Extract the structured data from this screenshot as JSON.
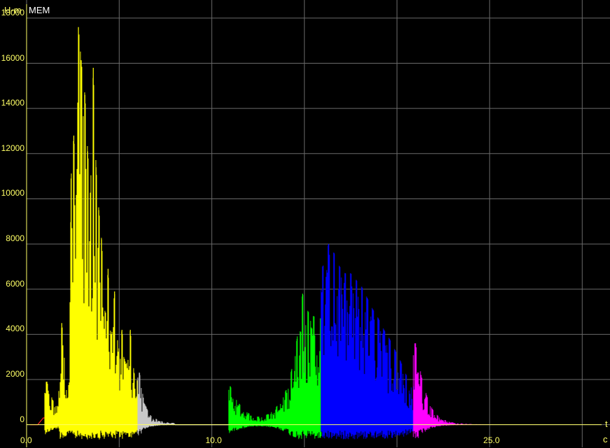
{
  "chart_data": {
    "type": "area",
    "ylabel": "Н·m",
    "title": "MEM",
    "xlabel": "t",
    "x_unit": "c",
    "xlim": [
      0,
      31.5
    ],
    "ylim": [
      -1000,
      18800
    ],
    "x_ticks": [
      0,
      5,
      10,
      15,
      20,
      25,
      30
    ],
    "x_tick_labels": [
      {
        "x": 0,
        "text": "0.0"
      },
      {
        "x": 10,
        "text": "10.0"
      },
      {
        "x": 25,
        "text": "25.0"
      }
    ],
    "y_ticks": [
      0,
      2000,
      4000,
      6000,
      8000,
      10000,
      12000,
      14000,
      16000,
      18000
    ],
    "y_tick_labels": [
      "0",
      "2000",
      "4000",
      "6000",
      "8000",
      "10000",
      "12000",
      "14000",
      "16000",
      "18000"
    ],
    "grid": true,
    "colors": {
      "background": "#000000",
      "grid": "#6a6a6a",
      "axis": "#ffff66",
      "text": "#ffff66",
      "title": "#ffffff"
    },
    "segments": [
      {
        "color": "#ff2020",
        "x_range": [
          0.2,
          1.0
        ],
        "points": [
          [
            0.2,
            0
          ],
          [
            0.6,
            0
          ],
          [
            0.9,
            300
          ],
          [
            1.0,
            300
          ]
        ]
      },
      {
        "color": "#ffff00",
        "x_range": [
          1.0,
          6.0
        ],
        "peaks": [
          [
            1.1,
            1900
          ],
          [
            1.4,
            1100
          ],
          [
            1.7,
            800
          ],
          [
            1.9,
            4500
          ],
          [
            2.3,
            1500
          ],
          [
            2.4,
            10900
          ],
          [
            2.55,
            12800
          ],
          [
            2.7,
            9800
          ],
          [
            2.8,
            17600
          ],
          [
            2.95,
            16100
          ],
          [
            3.15,
            14600
          ],
          [
            3.3,
            12100
          ],
          [
            3.45,
            10100
          ],
          [
            3.6,
            15800
          ],
          [
            3.75,
            11400
          ],
          [
            3.9,
            9500
          ],
          [
            4.05,
            8200
          ],
          [
            4.25,
            4700
          ],
          [
            4.4,
            6900
          ],
          [
            4.55,
            3800
          ],
          [
            4.75,
            5900
          ],
          [
            4.95,
            3200
          ],
          [
            5.15,
            4200
          ],
          [
            5.35,
            2600
          ],
          [
            5.6,
            4200
          ],
          [
            5.8,
            2300
          ],
          [
            6.0,
            1900
          ]
        ]
      },
      {
        "color": "#c8c8c8",
        "x_range": [
          6.0,
          8.0
        ],
        "peaks": [
          [
            6.1,
            2300
          ],
          [
            6.3,
            1200
          ],
          [
            6.5,
            700
          ],
          [
            6.7,
            400
          ],
          [
            7.0,
            250
          ],
          [
            7.3,
            150
          ],
          [
            7.6,
            100
          ],
          [
            7.9,
            80
          ]
        ]
      },
      {
        "color": "#ffffff",
        "x_range": [
          8.0,
          10.9
        ],
        "points": [
          [
            8.0,
            0
          ],
          [
            10.9,
            0
          ]
        ]
      },
      {
        "color": "#00ff00",
        "x_range": [
          10.9,
          15.9
        ],
        "peaks": [
          [
            11.0,
            1700
          ],
          [
            11.5,
            900
          ],
          [
            12.0,
            500
          ],
          [
            12.5,
            350
          ],
          [
            13.0,
            450
          ],
          [
            13.5,
            800
          ],
          [
            14.0,
            1500
          ],
          [
            14.3,
            2400
          ],
          [
            14.6,
            3800
          ],
          [
            14.9,
            5800
          ],
          [
            15.2,
            5000
          ],
          [
            15.5,
            4800
          ],
          [
            15.9,
            4700
          ]
        ]
      },
      {
        "color": "#0000ff",
        "x_range": [
          15.9,
          20.9
        ],
        "peaks": [
          [
            16.0,
            7000
          ],
          [
            16.3,
            8000
          ],
          [
            16.6,
            7600
          ],
          [
            16.9,
            7000
          ],
          [
            17.2,
            6700
          ],
          [
            17.5,
            6700
          ],
          [
            17.8,
            6400
          ],
          [
            18.1,
            6100
          ],
          [
            18.4,
            5600
          ],
          [
            18.7,
            5100
          ],
          [
            19.0,
            4700
          ],
          [
            19.3,
            4200
          ],
          [
            19.6,
            3800
          ],
          [
            19.9,
            3300
          ],
          [
            20.2,
            2800
          ],
          [
            20.5,
            2200
          ],
          [
            20.9,
            1700
          ]
        ]
      },
      {
        "color": "#ff00ff",
        "x_range": [
          20.9,
          26.2
        ],
        "peaks": [
          [
            21.0,
            3600
          ],
          [
            21.3,
            2200
          ],
          [
            21.6,
            1300
          ],
          [
            21.9,
            700
          ],
          [
            22.2,
            400
          ],
          [
            22.6,
            200
          ],
          [
            23.0,
            100
          ],
          [
            23.5,
            50
          ],
          [
            24.5,
            20
          ],
          [
            26.2,
            0
          ]
        ]
      }
    ]
  }
}
